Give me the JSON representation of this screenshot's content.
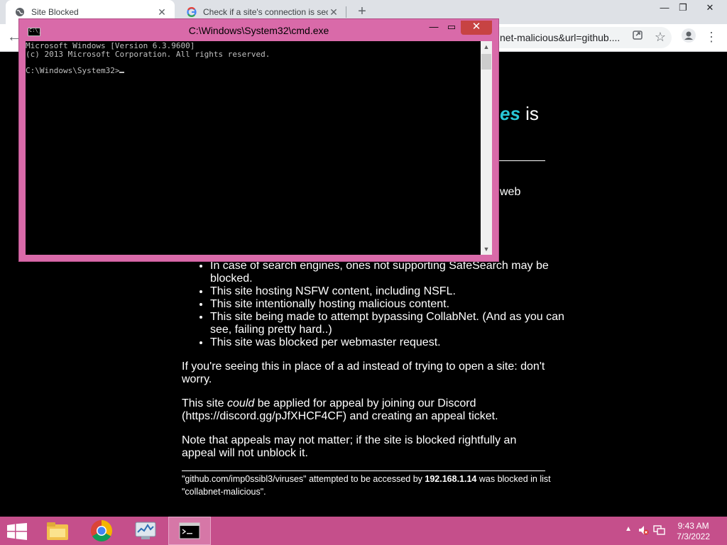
{
  "browser": {
    "tabs": [
      {
        "title": "Site Blocked",
        "icon": "globe-icon",
        "active": true
      },
      {
        "title": "Check if a site's connection is sec",
        "icon": "google-icon",
        "active": false
      }
    ],
    "new_tab": "+",
    "window_controls": {
      "minimize": "—",
      "maximize": "❐",
      "close": "✕"
    },
    "url_fragment": "net-malicious&url=github...."
  },
  "page": {
    "heading_accent": "es",
    "heading_tail": " is",
    "fragment_web": "web",
    "bullets": [
      "In case of search engines, ones not supporting SafeSearch may be blocked.",
      "This site hosting NSFW content, including NSFL.",
      "This site intentionally hosting malicious content.",
      "This site being made to attempt bypassing CollabNet. (And as you can see, failing pretty hard..)",
      "This site was blocked per webmaster request."
    ],
    "para_ad": "If you're seeing this in place of a ad instead of trying to open a site: don't worry.",
    "para_appeal_pre": "This site ",
    "para_appeal_em": "could",
    "para_appeal_post": " be applied for appeal by joining our Discord (https://discord.gg/pJfXHCF4CF) and creating an appeal ticket.",
    "para_note": "Note that appeals may not matter; if the site is blocked rightfully an appeal will not unblock it.",
    "footer_pre": "\"github.com/imp0ssibl3/viruses\" attempted to be accessed by ",
    "footer_ip": "192.168.1.14",
    "footer_mid": " was blocked in list \"collabnet-malicious\"."
  },
  "cmd": {
    "title": "C:\\Windows\\System32\\cmd.exe",
    "icon_text": "C:\\_",
    "line1": "Microsoft Windows [Version 6.3.9600]",
    "line2": "(c) 2013 Microsoft Corporation. All rights reserved.",
    "prompt": "C:\\Windows\\System32>"
  },
  "taskbar": {
    "apps": [
      "file-explorer-icon",
      "chrome-icon",
      "resource-monitor-icon",
      "cmd-icon"
    ],
    "time": "9:43 AM",
    "date": "7/3/2022"
  }
}
